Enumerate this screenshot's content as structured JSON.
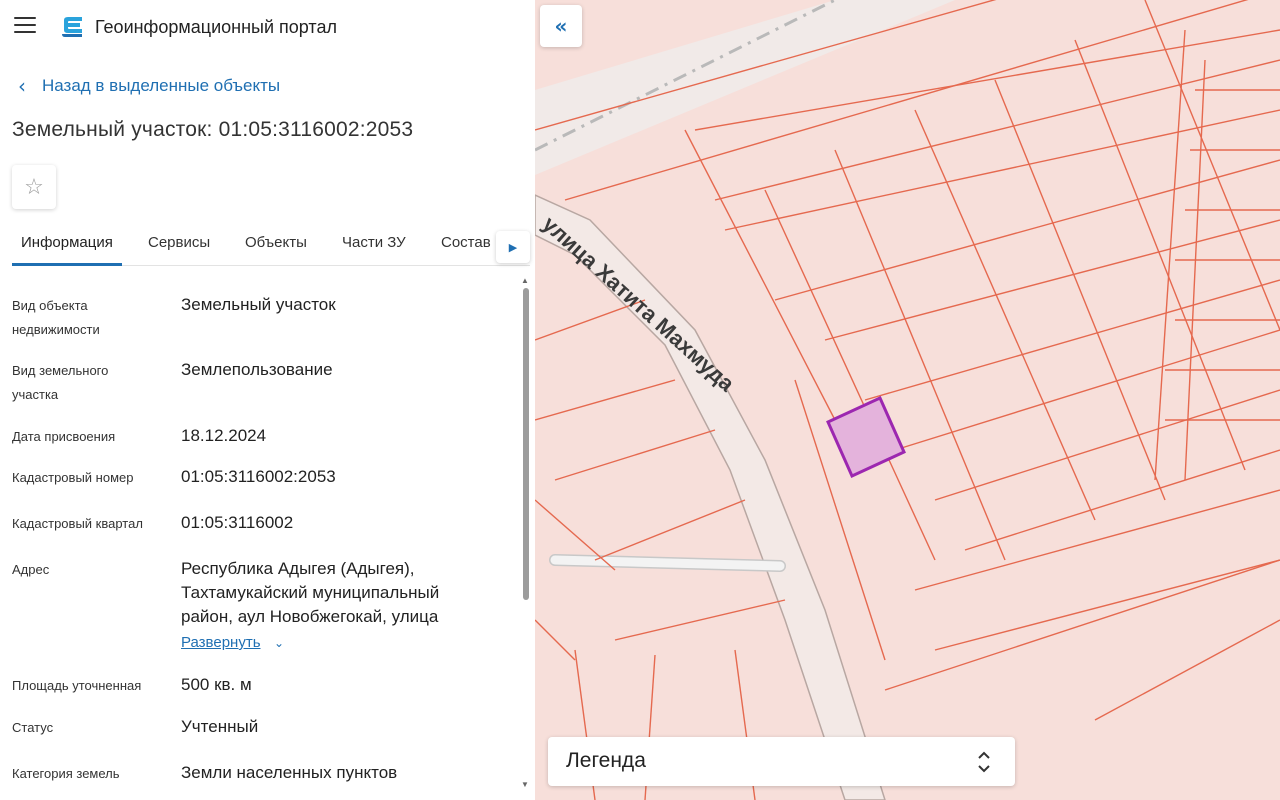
{
  "header": {
    "app_title": "Геоинформационный портал"
  },
  "navigation": {
    "back_label": "Назад в выделенные объекты"
  },
  "object": {
    "title": "Земельный участок: 01:05:3116002:2053"
  },
  "tabs": [
    {
      "label": "Информация",
      "active": true
    },
    {
      "label": "Сервисы",
      "active": false
    },
    {
      "label": "Объекты",
      "active": false
    },
    {
      "label": "Части ЗУ",
      "active": false
    },
    {
      "label": "Состав",
      "active": false
    }
  ],
  "info": {
    "rows": [
      {
        "label": "Вид объекта недвижимости",
        "value": "Земельный участок"
      },
      {
        "label": "Вид земельного участка",
        "value": "Землепользование"
      },
      {
        "label": "Дата присвоения",
        "value": "18.12.2024"
      },
      {
        "label": "Кадастровый номер",
        "value": "01:05:3116002:2053"
      },
      {
        "label": "Кадастровый квартал",
        "value": "01:05:3116002"
      },
      {
        "label": "Адрес",
        "value": "Республика Адыгея (Адыгея), Тахтамукайский муниципальный район, аул Новобжегокай, улица"
      },
      {
        "label": "Площадь уточненная",
        "value": "500 кв. м"
      },
      {
        "label": "Статус",
        "value": "Учтенный"
      },
      {
        "label": "Категория земель",
        "value": "Земли населенных пунктов"
      }
    ],
    "expand_label": "Развернуть"
  },
  "map": {
    "street_label": "улица Хатита Махмуда",
    "legend_label": "Легенда",
    "colors": {
      "background": "#f7dfda",
      "parcel_line": "#e5694f",
      "road": "#f2ecea",
      "selected_fill": "#e4b3dc",
      "selected_stroke": "#9c27b0",
      "accent": "#1f6fb2"
    }
  },
  "icons": {
    "menu": "hamburger-icon",
    "logo": "portal-logo-icon",
    "back": "chevron-left-icon",
    "favorite": "star-outline-icon",
    "tabs_next": "triangle-right-icon",
    "collapse": "double-chevron-left-icon",
    "expand": "chevron-down-icon",
    "legend_toggle": "unfold-icon"
  }
}
